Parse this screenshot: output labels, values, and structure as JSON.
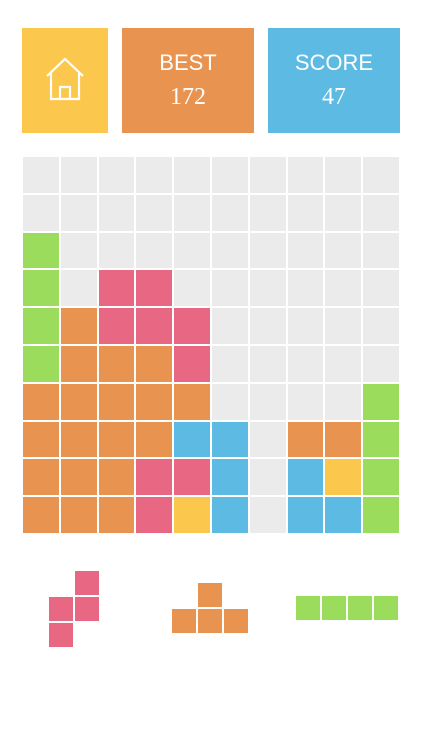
{
  "colors": {
    "empty": "#ebebeb",
    "yellow": "#fcc74d",
    "orange": "#e99350",
    "blue": "#5dbbe3",
    "pink": "#e86782",
    "green": "#9bdc5d"
  },
  "header": {
    "home": {
      "icon": "home-icon"
    },
    "best": {
      "label": "BEST",
      "value": "172"
    },
    "score": {
      "label": "SCORE",
      "value": "47"
    }
  },
  "board": {
    "rows": [
      "..........",
      "..........",
      "G.........",
      "G.PP......",
      "GOPPP.....",
      "GOOOP.....",
      "OOOOO....G",
      "OOOOBB.OOG",
      "OOOPPB.BYG",
      "OOOPYB.BBG"
    ]
  },
  "pieces": [
    {
      "name": "pink-s-piece",
      "color": "pink",
      "cells": [
        [
          0,
          1
        ],
        [
          1,
          0
        ],
        [
          1,
          1
        ],
        [
          2,
          0
        ]
      ]
    },
    {
      "name": "orange-t-piece",
      "color": "orange",
      "cells": [
        [
          0,
          1
        ],
        [
          1,
          0
        ],
        [
          1,
          1
        ],
        [
          1,
          2
        ]
      ]
    },
    {
      "name": "green-i-piece",
      "color": "green",
      "cells": [
        [
          0,
          0
        ],
        [
          0,
          1
        ],
        [
          0,
          2
        ],
        [
          0,
          3
        ]
      ]
    }
  ]
}
